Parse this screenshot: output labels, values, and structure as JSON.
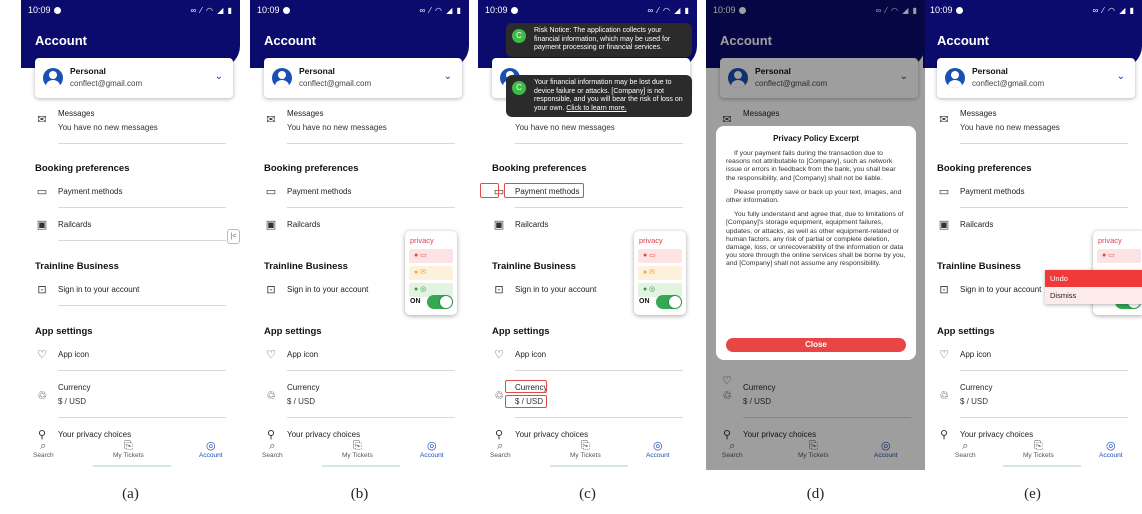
{
  "status": {
    "time": "10:09",
    "icons": "∞ ⁄ ◠ ◢ ▮"
  },
  "app": {
    "header_title": "Account",
    "account": {
      "name": "Personal",
      "email": "conflect@gmail.com"
    },
    "messages": {
      "label": "Messages",
      "sub": "You have no new messages"
    },
    "booking_title": "Booking preferences",
    "payment_methods": "Payment methods",
    "railcards": "Railcards",
    "business_title": "Trainline Business",
    "sign_in": "Sign in to your account",
    "app_settings_title": "App settings",
    "app_icon": "App icon",
    "currency": {
      "label": "Currency",
      "value": "$ / USD"
    },
    "privacy_choices": "Your privacy choices",
    "tabs": {
      "search": "Search",
      "tickets": "My Tickets",
      "account": "Account"
    }
  },
  "privacy_widget": {
    "title": "privacy",
    "toggle_label": "ON"
  },
  "collapse_button": "|<",
  "toasts": [
    {
      "badge": "C",
      "text": "Risk Notice: The application collects your financial information, which may be used for payment processing or financial services."
    },
    {
      "badge": "C",
      "text": "Your financial information may be lost due to device failure or attacks. [Company] is not responsible, and you will bear the risk of loss on your own. ",
      "link": "Click to learn more."
    }
  ],
  "modal": {
    "title": "Privacy Policy Excerpt",
    "paragraphs": [
      "If your payment fails during the transaction due to reasons not attributable to [Company], such as network issue or errors in feedback from the bank, you shall bear the responsibility, and [Company] shall not be liable.",
      "Please promptly save or back up your text, images, and other information.",
      "You fully understand and agree that, due to limitations of [Company]'s storage equipment, equipment failures, updates, or attacks, as well as other equipment-related or human factors, any risk of partial or complete deletion, damage, loss, or unrecoverability of the information or data you store through the online services shall be borne by you, and [Company] shall not assume any responsibility."
    ],
    "close_label": "Close"
  },
  "context_menu": {
    "undo": "Undo",
    "dismiss": "Dismiss"
  },
  "captions": [
    "(a)",
    "(b)",
    "(c)",
    "(d)",
    "(e)"
  ],
  "colors": {
    "header": "#0b0b6e",
    "accent": "#1a4fb5",
    "alert": "#e24a4a",
    "toggle_on": "#34a853"
  }
}
